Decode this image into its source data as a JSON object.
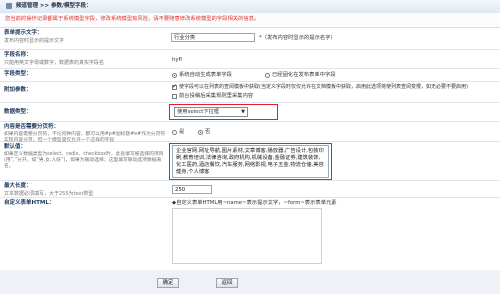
{
  "breadcrumb": "频道管理 >> 参数/模型字段：",
  "notice": "您当前的操作记录都属于系统模型字段，修改系统模型有风险，请不要随意修改系统模型的字段相关的信息。",
  "fields": {
    "title_label": "表单提示文字：",
    "title_hint": "发布内容时显示的提示文字",
    "title_value": "行业分类",
    "title_note": "*（发布内容时显示的提示名字）",
    "name_label": "字段名称：",
    "name_hint": "只能用英文字母或数字，数据表的真实字段名",
    "name_value": "hyfl",
    "type_label": "字段类型：",
    "type_opt1": "系统自动生成表单字段",
    "type_opt2": "已经固化在发布表单中字段",
    "attr_label": "附加参数：",
    "attr_opt1": "使字段可以在列表的查阅模板中获取(当定义字段时仅仅允许在文档模板中获取，启用此选项将使列表查阅变慢，如无必要不要启用)",
    "attr_opt2": "前台投稿后采集规则里采集内容",
    "datatype_label": "数据类型：",
    "datatype_value": "使用select下拉框",
    "required_label": "内容是否需要分页符：",
    "required_hint": "如果内容需要分页符，不论何种内容，都可以用#p#副标题#e#作为分页符实现内容分页，但一个模型里仅允许一个这样的字段",
    "required_yes": "是",
    "required_no": "否",
    "default_label": "默认值：",
    "default_hint": "如果定义数据类型为select、radio、checkbox时，此处填写被选择的项目(用“,”分开，如“男,女,人妖”)，如果为联动选择，这里填写联动选项数据表名。",
    "default_value": "企业官网,网址导航,图片素材,文章博客,播放器,广告设计,包装印刷,教育培训,法律咨询,政府机构,机械设备,金融证券,建筑装饰,化工医药,酒店餐饮,汽车服务,网络影视,电子五金,物流仓储,美容健身,个人博客",
    "maxlen_label": "最大长度：",
    "maxlen_hint": "文本数据必须填写，大于255为text类型",
    "maxlen_value": "250",
    "custom_label": "自定义表单HTML：",
    "custom_note": "◆自定义表单HTML用~name~表示提示文字，~form~表示表单元素"
  },
  "buttons": {
    "ok": "确定",
    "back": "返回"
  }
}
